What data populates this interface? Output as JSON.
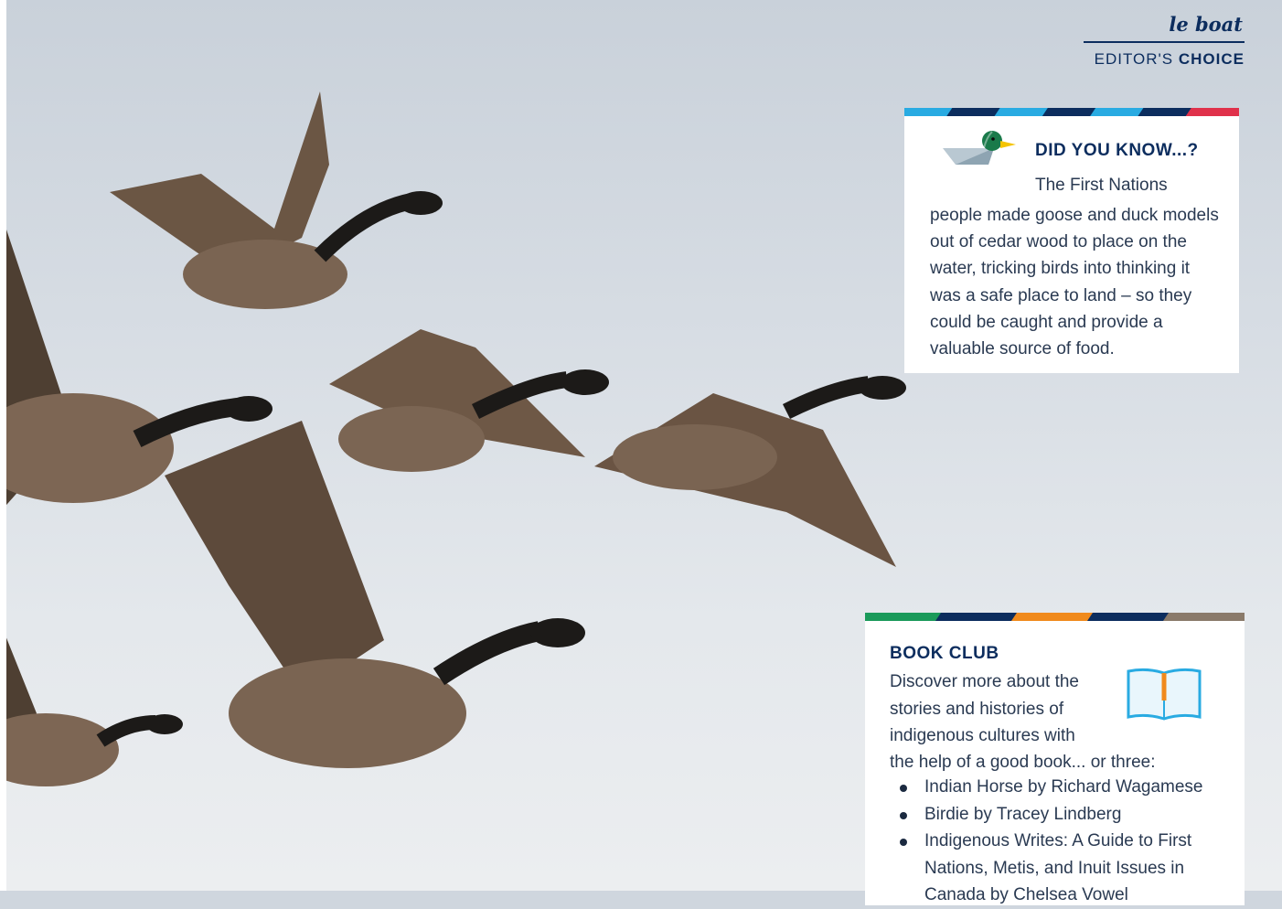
{
  "brand": {
    "name": "le boat",
    "subtitle_prefix": "EDITOR'S",
    "subtitle_bold": "CHOICE"
  },
  "did_you_know": {
    "title": "DID YOU KNOW...?",
    "first_line": "The First Nations",
    "body": "people made goose and duck models out of cedar wood to place on the water, tricking birds into thinking it was a safe place to land – so they could be caught and provide a valuable source of food.",
    "icon": "duck-decoy-icon",
    "stripe_colors": [
      "#29abe2",
      "#0c2d5e",
      "#29abe2",
      "#0c2d5e",
      "#29abe2",
      "#0c2d5e",
      "#e0314b"
    ]
  },
  "book_club": {
    "title": "BOOK CLUB",
    "intro": "Discover more about the stories and histories of indigenous cultures with",
    "intro_last": "the help of a good book... or three:",
    "icon": "open-book-icon",
    "books": [
      "Indian Horse by Richard Wagamese",
      "Birdie by Tracey Lindberg",
      "Indigenous Writes: A Guide to First Nations, Metis, and Inuit Issues in Canada by Chelsea Vowel"
    ],
    "stripe_colors": [
      "#1a9a5a",
      "#0c2d5e",
      "#f08a1c",
      "#0c2d5e",
      "#8a7a6a"
    ]
  },
  "photo": {
    "subject": "canada-geese-in-flight-image",
    "sky_color": "#d6dce3"
  }
}
